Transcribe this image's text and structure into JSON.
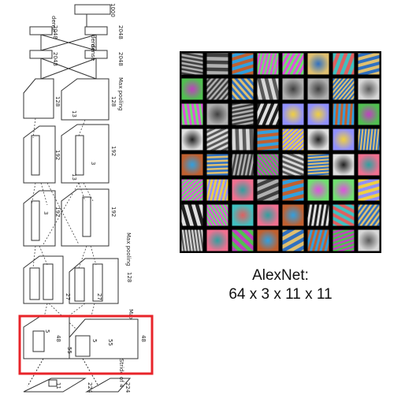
{
  "diagram": {
    "labels": {
      "dense_top": "dense",
      "output": "1000",
      "dense_a": "dense",
      "dense_b": "dense",
      "n2048": "2048",
      "max_pooling": "Max pooling",
      "n128": "128",
      "n13": "13",
      "n192": "192",
      "n3": "3",
      "n27": "27",
      "n5": "5",
      "n48": "48",
      "n55": "55",
      "n11": "11",
      "n224": "224",
      "stride": "Stride of 4"
    },
    "highlight_color": "#e8242a"
  },
  "filters": {
    "grid_rows": 8,
    "grid_cols": 8,
    "caption_line1": "AlexNet:",
    "caption_line2": "64 x 3 x 11 x 11"
  }
}
